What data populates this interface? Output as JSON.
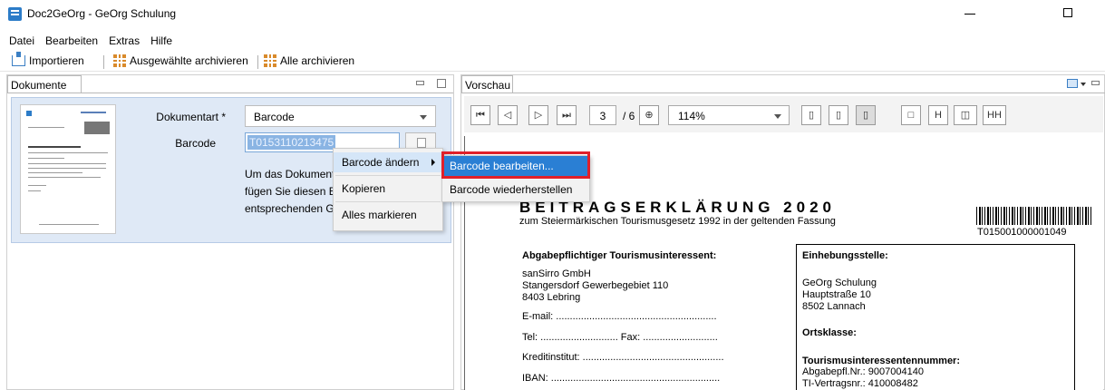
{
  "window": {
    "title": "Doc2GeOrg - GeOrg Schulung"
  },
  "menu": [
    "Datei",
    "Bearbeiten",
    "Extras",
    "Hilfe"
  ],
  "toolbar": {
    "import": "Importieren",
    "archive_selected": "Ausgewählte archivieren",
    "archive_all": "Alle archivieren"
  },
  "left_panel": {
    "tab": "Dokumente",
    "doc_type_label": "Dokumentart *",
    "doc_type_value": "Barcode",
    "barcode_label": "Barcode",
    "barcode_value": "T0153110213475",
    "info_lines": [
      "Um das Dokument",
      "fügen Sie diesen B",
      "entsprechenden G"
    ]
  },
  "context_menu": {
    "items": [
      "Barcode ändern",
      "Kopieren",
      "Alles markieren"
    ]
  },
  "submenu": {
    "items": [
      "Barcode bearbeiten...",
      "Barcode wiederherstellen"
    ]
  },
  "preview": {
    "tab": "Vorschau",
    "page_current": "3",
    "page_total": "/ 6",
    "zoom": "114%",
    "doc": {
      "title": "BEITRAGSERKLÄRUNG 2020",
      "subtitle": "zum Steiermärkischen Tourismusgesetz 1992 in der geltenden Fassung",
      "barcode_number": "T015001000001049",
      "left_heading": "Abgabepflichtiger Tourismusinteressent:",
      "company": "sanSirro GmbH",
      "street": "Stangersdorf Gewerbegebiet 110",
      "city": "8403 Lebring",
      "email": "E-mail: ..........................................................",
      "tel": "Tel: ............................ Fax: ...........................",
      "bank": "Kreditinstitut: ...................................................",
      "iban": "IBAN: .............................................................",
      "right_heading": "Einhebungsstelle:",
      "r_name": "GeOrg Schulung",
      "r_street": "Hauptstraße 10",
      "r_city": "8502 Lannach",
      "class": "Ortsklasse:",
      "nr_heading": "Tourismusinteressentennummer:",
      "nr1": "Abgabepfl.Nr.: 9007004140",
      "nr2": "TI-Vertragsnr.: 410008482"
    }
  }
}
